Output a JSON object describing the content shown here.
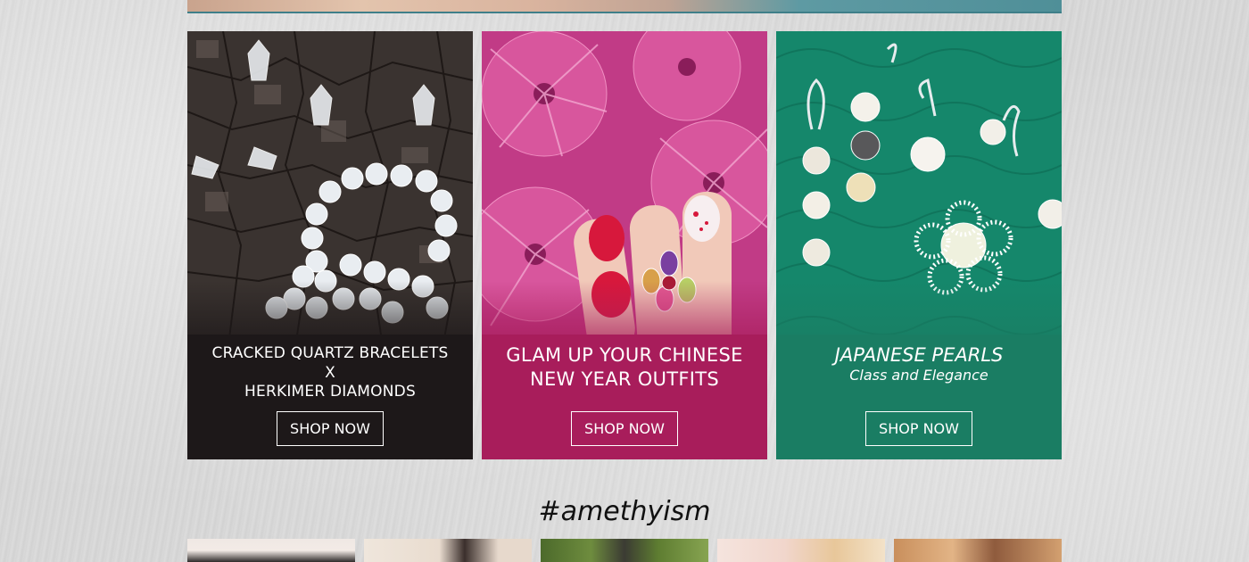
{
  "promos": [
    {
      "caption_lines": [
        "CRACKED QUARTZ BRACELETS",
        "X",
        "HERKIMER DIAMONDS"
      ],
      "button_label": "SHOP NOW",
      "panel_color": "#1d1819"
    },
    {
      "caption_lines": [
        "GLAM UP YOUR CHINESE",
        "NEW YEAR OUTFITS"
      ],
      "button_label": "SHOP NOW",
      "panel_color": "#a81d5b"
    },
    {
      "title": "JAPANESE PEARLS",
      "subtitle": "Class and Elegance",
      "button_label": "SHOP NOW",
      "panel_color": "#1a7d63"
    }
  ],
  "instagram": {
    "hashtag": "#amethyism"
  }
}
